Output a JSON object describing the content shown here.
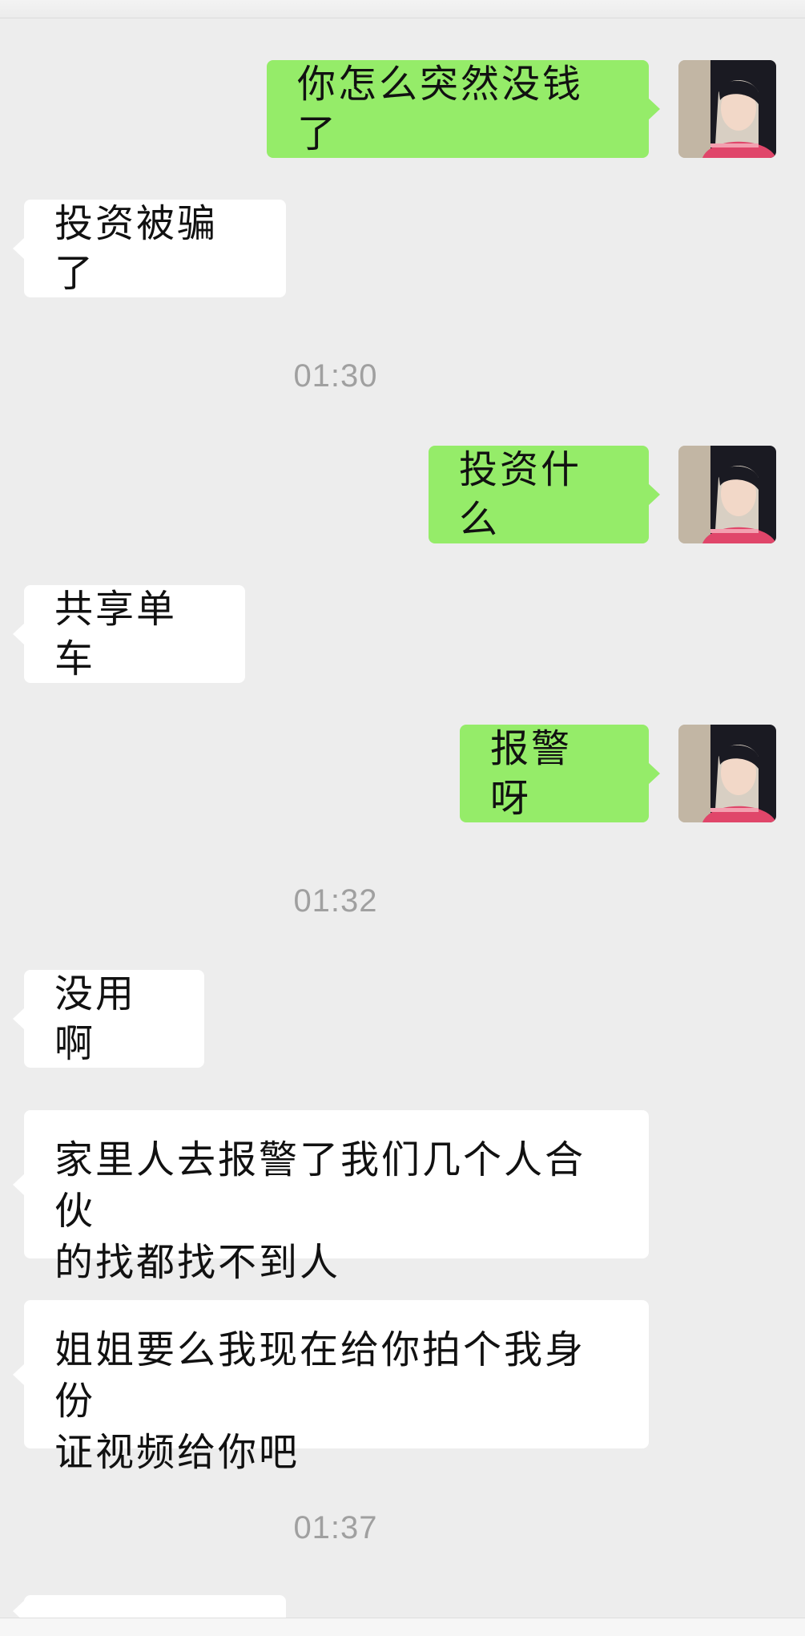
{
  "chat": {
    "messages": [
      {
        "side": "right",
        "text": "你怎么突然没钱了"
      },
      {
        "side": "left",
        "text": "投资被骗了"
      },
      {
        "type": "time",
        "text": "01:30"
      },
      {
        "side": "right",
        "text": "投资什么"
      },
      {
        "side": "left",
        "text": "共享单车"
      },
      {
        "side": "right",
        "text": "报警 呀"
      },
      {
        "type": "time",
        "text": "01:32"
      },
      {
        "side": "left",
        "text": "没用啊"
      },
      {
        "side": "left",
        "lines": [
          "家里人去报警了我们几个人合伙",
          "的找都找不到人"
        ]
      },
      {
        "side": "left",
        "lines": [
          "姐姐要么我现在给你拍个我身份",
          "证视频给你吧"
        ]
      },
      {
        "type": "time",
        "text": "01:37"
      }
    ]
  },
  "colors": {
    "background": "#ededed",
    "outgoing_bubble": "#95ec69",
    "incoming_bubble": "#ffffff",
    "timestamp": "#a0a0a0"
  },
  "icons": {
    "avatar": "user-avatar-photo"
  }
}
